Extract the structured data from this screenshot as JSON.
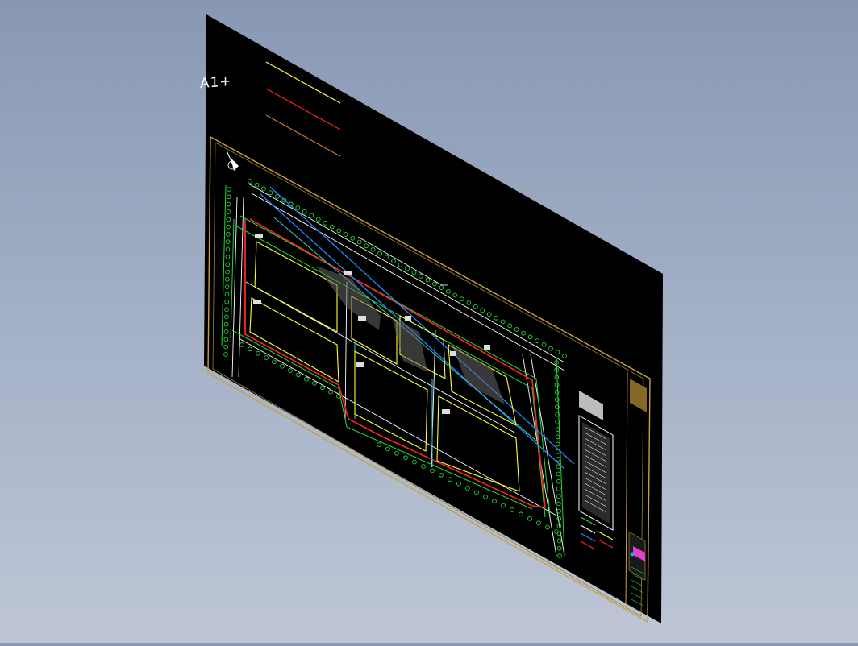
{
  "viewport": {
    "background_top": "#8898b4",
    "background_bottom": "#bec6d6"
  },
  "sheet": {
    "label": "A1+",
    "background": "#000000",
    "frame_color": "#c8a23c"
  },
  "legend_lines": [
    {
      "name": "yellow-line",
      "color": "#ffff33"
    },
    {
      "name": "red-line",
      "color": "#ff2222"
    },
    {
      "name": "orange-line",
      "color": "#d08040"
    }
  ],
  "colors": {
    "road": "#ffffff",
    "boundary": "#ff2222",
    "green_belt": "#22dd33",
    "parcel": "#ffff33",
    "water_pipe": "#2288ff",
    "cyan_pipe": "#33cccc",
    "gray_hatch": "#888888",
    "tree_symbol": "#22dd33"
  }
}
